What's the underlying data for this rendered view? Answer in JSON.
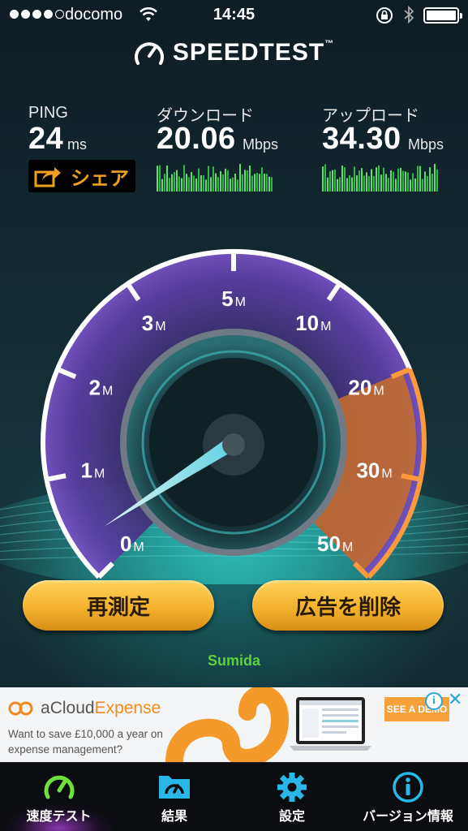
{
  "status_bar": {
    "carrier": "docomo",
    "time": "14:45",
    "signal_bars": 4,
    "signal_max": 5
  },
  "app": {
    "title": "SPEEDTEST",
    "trademark": "™"
  },
  "results": {
    "ping": {
      "label": "PING",
      "value": "24",
      "unit": "ms"
    },
    "download": {
      "label": "ダウンロード",
      "value": "20.06",
      "unit": "Mbps"
    },
    "upload": {
      "label": "アップロード",
      "value": "34.30",
      "unit": "Mbps"
    },
    "share_label": "シェア"
  },
  "gauge": {
    "ticks": [
      {
        "num": "0",
        "unit": "M"
      },
      {
        "num": "1",
        "unit": "M"
      },
      {
        "num": "2",
        "unit": "M"
      },
      {
        "num": "3",
        "unit": "M"
      },
      {
        "num": "5",
        "unit": "M"
      },
      {
        "num": "10",
        "unit": "M"
      },
      {
        "num": "20",
        "unit": "M"
      },
      {
        "num": "30",
        "unit": "M"
      },
      {
        "num": "50",
        "unit": "M"
      }
    ],
    "needle_value_label": "0"
  },
  "actions": {
    "retest": "再測定",
    "remove_ads": "広告を削除"
  },
  "server": "Sumida",
  "ad": {
    "brand_prefix": "a",
    "brand_cloud": "Cloud",
    "brand_suffix": "Expense",
    "copy": "Want to save £10,000 a year on expense management?",
    "cta": "SEE A DEMO"
  },
  "tabs": [
    {
      "label": "速度テスト",
      "icon": "speedometer-icon",
      "active": true
    },
    {
      "label": "結果",
      "icon": "folder-gauge-icon",
      "active": false
    },
    {
      "label": "設定",
      "icon": "gear-icon",
      "active": false
    },
    {
      "label": "バージョン情報",
      "icon": "info-icon",
      "active": false
    }
  ],
  "colors": {
    "accent_orange": "#f3b22d",
    "download_green": "#3fcf4a",
    "gauge_purple": "#6a3fb8",
    "tab_icon_blue": "#29b7e8"
  }
}
